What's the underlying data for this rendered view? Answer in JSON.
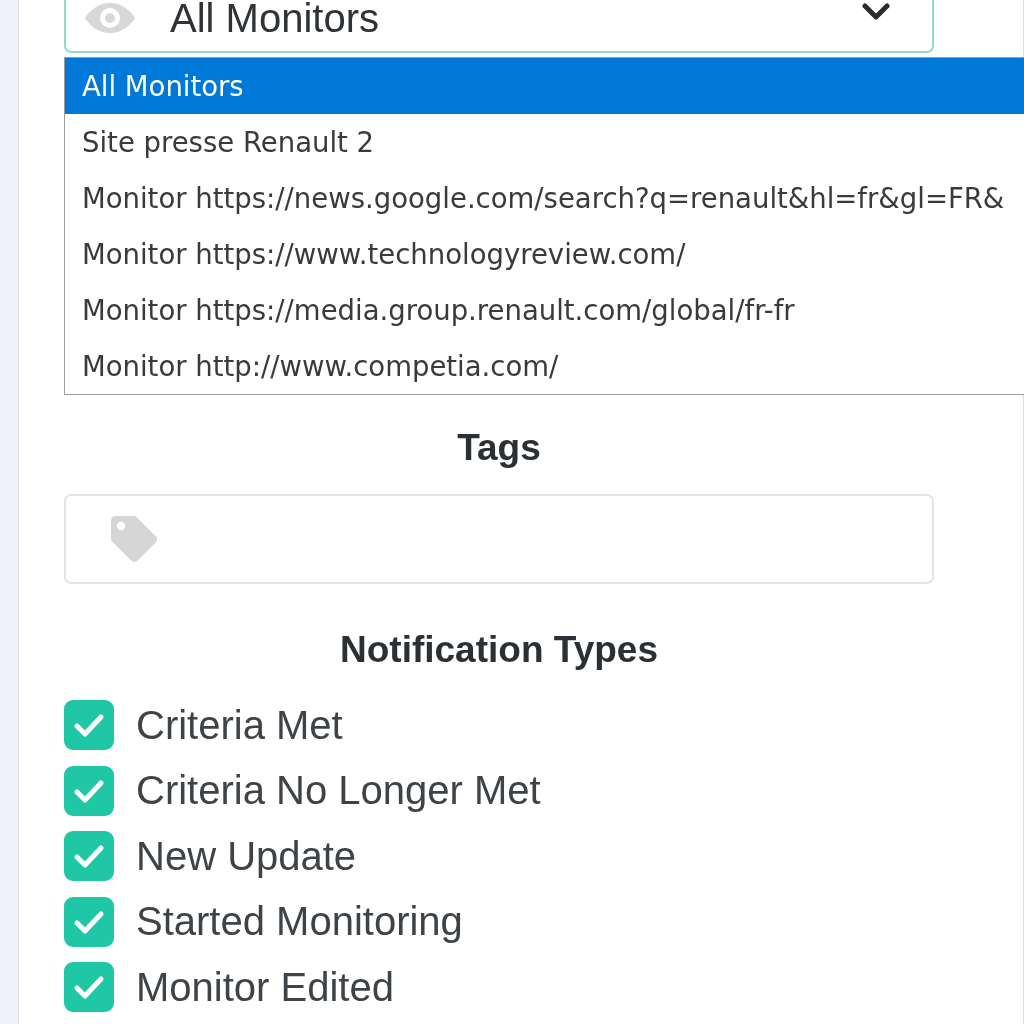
{
  "monitor_select": {
    "value": "All Monitors",
    "expanded": true,
    "options": [
      {
        "label": "All Monitors",
        "selected": true
      },
      {
        "label": "Site presse Renault 2",
        "selected": false
      },
      {
        "label": "Monitor https://news.google.com/search?q=renault&hl=fr&gl=FR&",
        "selected": false
      },
      {
        "label": "Monitor https://www.technologyreview.com/",
        "selected": false
      },
      {
        "label": "Monitor https://media.group.renault.com/global/fr-fr",
        "selected": false
      },
      {
        "label": "Monitor http://www.competia.com/",
        "selected": false
      }
    ]
  },
  "tags": {
    "heading": "Tags"
  },
  "notification_types": {
    "heading": "Notification Types",
    "items": [
      {
        "label": "Criteria Met",
        "checked": true
      },
      {
        "label": "Criteria No Longer Met",
        "checked": true
      },
      {
        "label": "New Update",
        "checked": true
      },
      {
        "label": "Started Monitoring",
        "checked": true
      },
      {
        "label": "Monitor Edited",
        "checked": true
      }
    ]
  }
}
